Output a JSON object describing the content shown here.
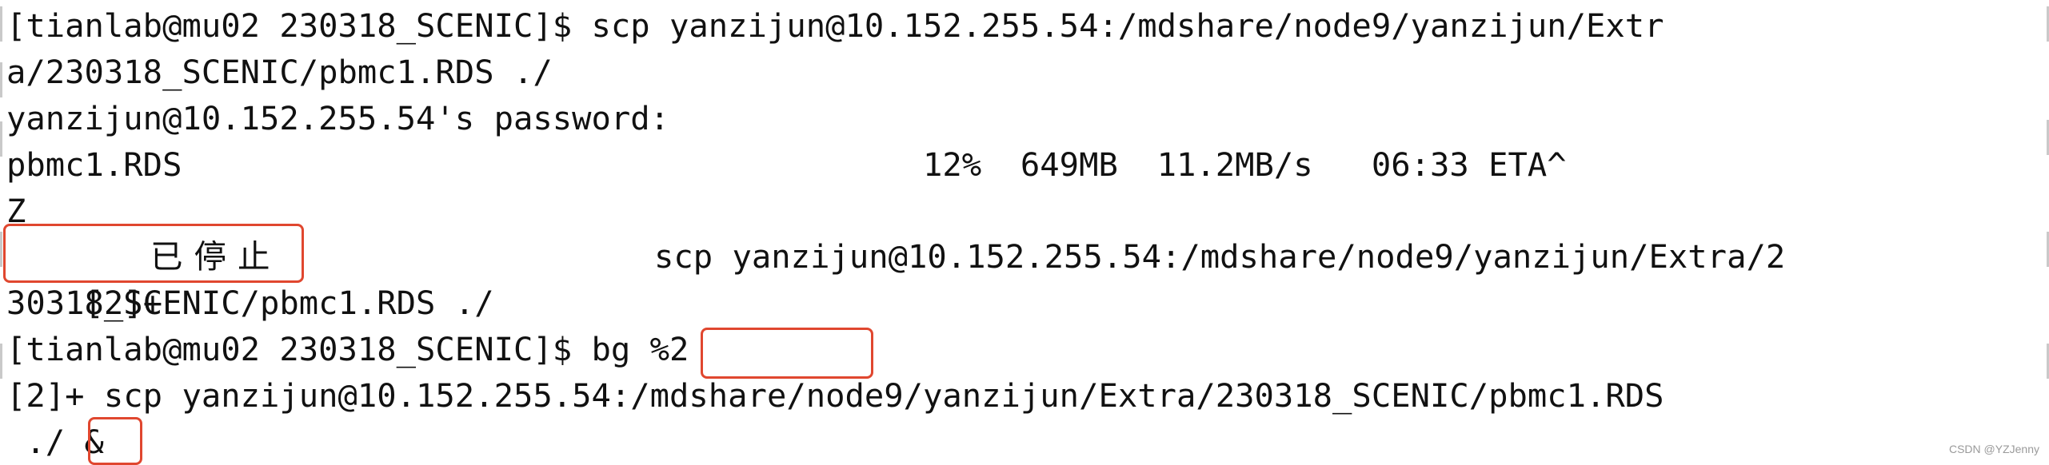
{
  "terminal": {
    "lines": [
      "[tianlab@mu02 230318_SCENIC]$ scp yanzijun@10.152.255.54:/mdshare/node9/yanzijun/Extr",
      "a/230318_SCENIC/pbmc1.RDS ./",
      "yanzijun@10.152.255.54's password:",
      "pbmc1.RDS                                      12%  649MB  11.2MB/s   06:33 ETA^",
      "Z",
      "[2]+           ",
      "30318_SCENIC/pbmc1.RDS ./",
      "[tianlab@mu02 230318_SCENIC]$ bg %2",
      "[2]+ scp yanzijun@10.152.255.54:/mdshare/node9/yanzijun/Extra/230318_SCENIC/pbmc1.RDS",
      " ./ &"
    ],
    "stopped_status": "已停止",
    "stopped_command": "scp yanzijun@10.152.255.54:/mdshare/node9/yanzijun/Extra/2",
    "highlights": {
      "job_stopped": "[2]+  已停止",
      "bg_command": "bg %2",
      "ampersand": "&"
    }
  },
  "watermark": "CSDN @YZJenny"
}
